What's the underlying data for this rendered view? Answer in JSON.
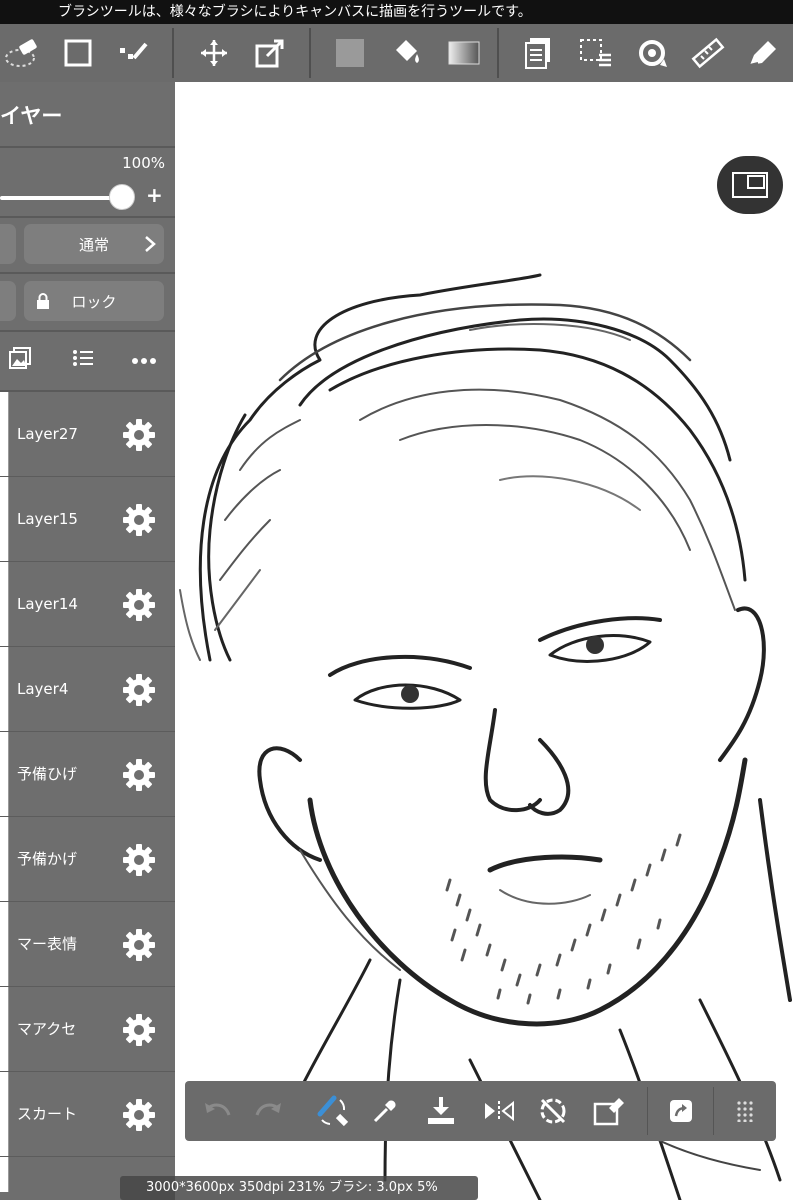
{
  "hint": "ブラシツールは、様々なブラシによりキャンバスに描画を行うツールです。",
  "toolbar": {
    "tools": [
      "eraser-icon",
      "square-selection-icon",
      "check-icon",
      "move-icon",
      "transform-icon",
      "fill-square-icon",
      "bucket-icon",
      "gradient-icon",
      "layer-copy-icon",
      "select-list-icon",
      "rotate-icon",
      "ruler-icon",
      "pen-icon"
    ]
  },
  "layer_panel": {
    "title": "イヤー",
    "opacity": "100%",
    "opacity_level": 1.0,
    "blend_mode": "通常",
    "lock_label": "ロック",
    "layers": [
      {
        "name": "Layer27"
      },
      {
        "name": "Layer15"
      },
      {
        "name": "Layer14"
      },
      {
        "name": "Layer4"
      },
      {
        "name": "予備ひげ"
      },
      {
        "name": "予備かげ"
      },
      {
        "name": "マー表情"
      },
      {
        "name": "マアクセ"
      },
      {
        "name": "スカート"
      }
    ]
  },
  "status": "3000*3600px 350dpi 231% ブラシ: 3.0px 5%",
  "colors": {
    "toolbar_bg": "#6b6b6b",
    "panel_bg": "#6e6e6e",
    "accent_blue": "#3b8fd6"
  }
}
